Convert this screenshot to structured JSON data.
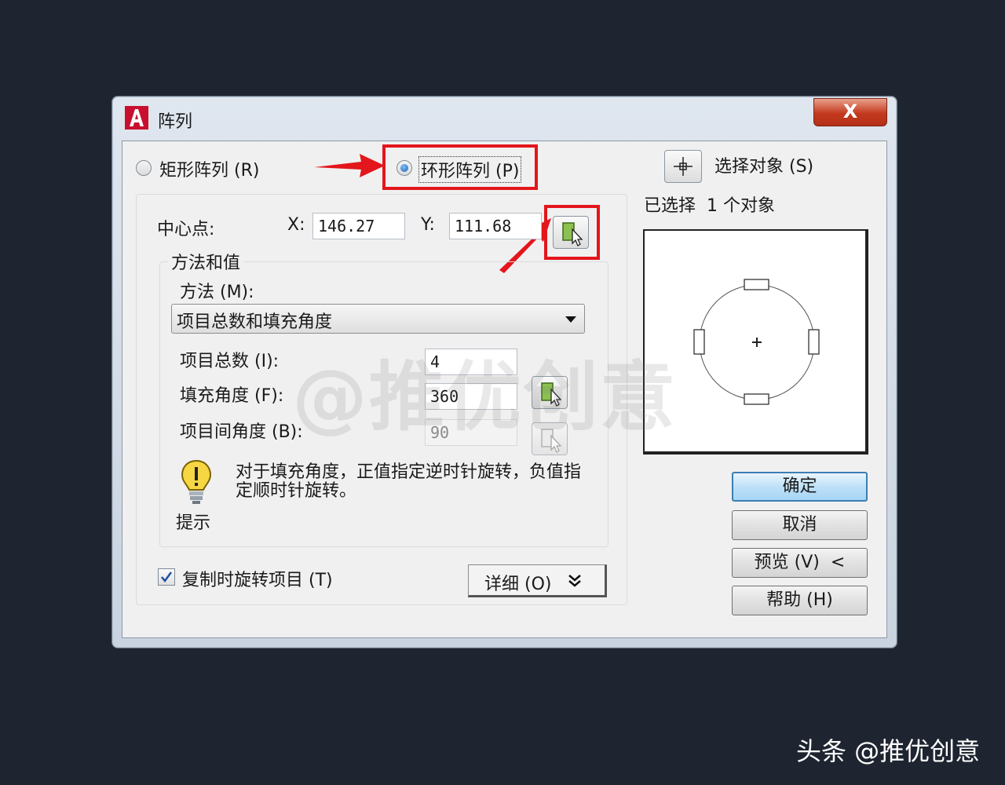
{
  "window": {
    "title": "阵列",
    "close_label": "X"
  },
  "array_type": {
    "rect_label": "矩形阵列 (R)",
    "rect_selected": false,
    "polar_label": "环形阵列 (P)",
    "polar_selected": true
  },
  "center": {
    "label": "中心点:",
    "x_label": "X:",
    "x_value": "146.27",
    "y_label": "Y:",
    "y_value": "111.68"
  },
  "method_group": {
    "title": "方法和值",
    "method_label": "方法 (M):",
    "method_selected": "项目总数和填充角度",
    "total_label": "项目总数 (I):",
    "total_value": "4",
    "fill_label": "填充角度 (F):",
    "fill_value": "360",
    "between_label": "项目间角度 (B):",
    "between_value": "90",
    "tip_text": "对于填充角度，正值指定逆时针旋转，负值指定顺时针旋转。",
    "tip_label": "提示"
  },
  "rotate": {
    "label": "复制时旋转项目 (T)",
    "checked": true
  },
  "details_label": "详细 (O)",
  "selection": {
    "select_label": "选择对象 (S)",
    "selected_text": "已选择  1 个对象"
  },
  "buttons": {
    "ok": "确定",
    "cancel": "取消",
    "preview": "预览 (V)  <",
    "help": "帮助 (H)"
  },
  "watermark": "@推优创意",
  "footer_watermark": "头条 @推优创意",
  "colors": {
    "highlight": "#e3161c",
    "background": "#1e2530"
  }
}
